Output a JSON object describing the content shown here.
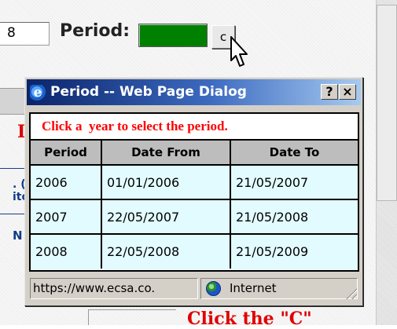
{
  "background": {
    "year_input_value": "8",
    "period_label": "Period:",
    "swatch_color": "#008000",
    "c_button_label": "c",
    "fragment_red": "I",
    "fragment_blue_1": ". (",
    "fragment_blue_1b": "ito",
    "fragment_blue_2": "N",
    "fragment_bottom_red": "Click the \"C\""
  },
  "dialog": {
    "title": "Period -- Web Page Dialog",
    "title_icon": "internet-explorer-icon",
    "help_button_label": "?",
    "close_button_label": "×",
    "instruction": "Click a  year to select the period.",
    "table": {
      "columns": [
        "Period",
        "Date From",
        "Date To"
      ],
      "rows": [
        [
          "2006",
          "01/01/2006",
          "21/05/2007"
        ],
        [
          "2007",
          "22/05/2007",
          "21/05/2008"
        ],
        [
          "2008",
          "22/05/2008",
          "21/05/2009"
        ]
      ]
    },
    "status_url": "https://www.ecsa.co.",
    "status_zone": "Internet",
    "status_zone_icon": "globe-icon"
  },
  "colors": {
    "titlebar_start": "#0a246a",
    "titlebar_end": "#a6caf0",
    "instruction_text": "#ff0000",
    "cell_background": "#e2fbff",
    "header_background": "#bdbdbd"
  }
}
